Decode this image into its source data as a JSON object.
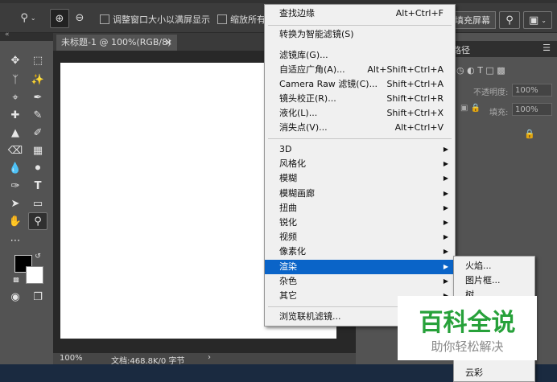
{
  "options_bar": {
    "checkbox_resize": "调整窗口大小以满屏显示",
    "checkbox_zoom_all": "缩放所有",
    "fill_screen": "填充屏幕"
  },
  "document": {
    "tab_title": "未标题-1 @ 100%(RGB/8)",
    "tab_close": "×",
    "zoom": "100%",
    "doc_info": "文档:468.8K/0 字节",
    "status_arrow": "›"
  },
  "panels": {
    "tab_paths": "路径",
    "opacity_label": "不透明度:",
    "opacity_value": "100%",
    "fill_label": "填充:",
    "fill_value": "100%"
  },
  "filter_menu": {
    "items_top": [
      {
        "label": "查找边缘",
        "shortcut": "Alt+Ctrl+F"
      },
      {
        "label": "转换为智能滤镜(S)",
        "shortcut": ""
      }
    ],
    "items_mid": [
      {
        "label": "滤镜库(G)...",
        "shortcut": ""
      },
      {
        "label": "自适应广角(A)...",
        "shortcut": "Alt+Shift+Ctrl+A"
      },
      {
        "label": "Camera Raw 滤镜(C)...",
        "shortcut": "Shift+Ctrl+A"
      },
      {
        "label": "镜头校正(R)...",
        "shortcut": "Shift+Ctrl+R"
      },
      {
        "label": "液化(L)...",
        "shortcut": "Shift+Ctrl+X"
      },
      {
        "label": "消失点(V)...",
        "shortcut": "Alt+Ctrl+V"
      }
    ],
    "submenus": [
      "3D",
      "风格化",
      "模糊",
      "模糊画廊",
      "扭曲",
      "锐化",
      "视频",
      "像素化",
      "渲染",
      "杂色",
      "其它"
    ],
    "highlighted": "渲染",
    "browse": "浏览联机滤镜..."
  },
  "render_submenu": {
    "items": [
      "火焰...",
      "图片框...",
      "树...",
      "云彩"
    ]
  },
  "watermark": {
    "title": "百科全说",
    "subtitle": "助你轻松解决"
  }
}
